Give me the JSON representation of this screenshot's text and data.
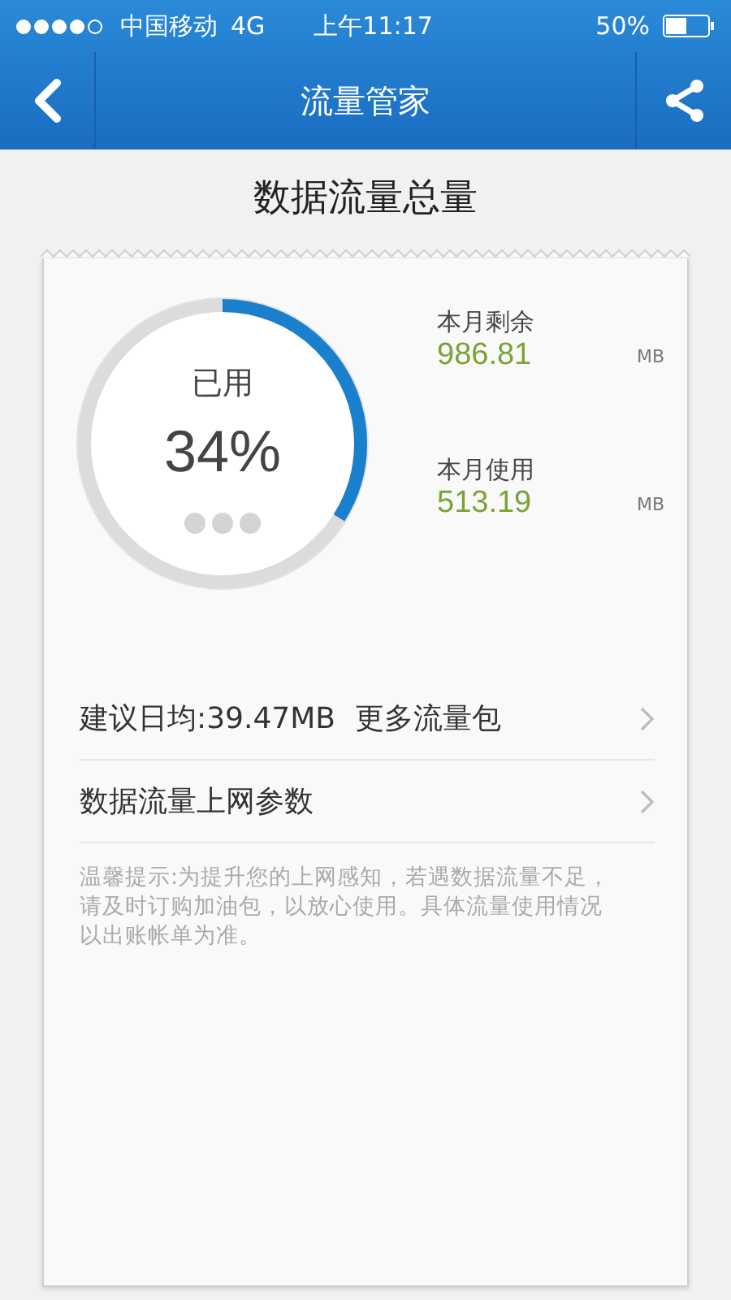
{
  "status_bar": {
    "carrier": "中国移动",
    "network": "4G",
    "time": "上午11:17",
    "battery": "50%"
  },
  "nav": {
    "title": "流量管家"
  },
  "heading": "数据流量总量",
  "usage": {
    "label": "已用",
    "percent": "34%",
    "level": 0.34
  },
  "stats": [
    {
      "label": "本月剩余",
      "value": "986.81",
      "unit": "MB"
    },
    {
      "label": "本月使用",
      "value": "513.19",
      "unit": "MB"
    }
  ],
  "rows": [
    {
      "label": "建议日均:39.47MB",
      "extra": "更多流量包"
    },
    {
      "label": "数据流量上网参数"
    }
  ],
  "tip": "温馨提示:为提升您的上网感知，若遇数据流量不足，请及时订购加油包，以放心使用。具体流量使用情况以出账帐单为准。"
}
